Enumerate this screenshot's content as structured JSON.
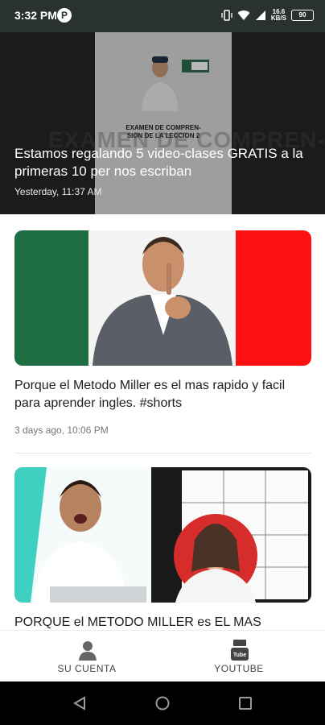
{
  "status_bar": {
    "time": "3:32 PM",
    "badge": "P",
    "net_speed": "16.6\nKB/S",
    "battery": "90"
  },
  "hero": {
    "title": "Estamos regalando 5 video-clases GRATIS a la primeras 10 per nos escriban",
    "time": "Yesterday, 11:37 AM",
    "thumb_text": "EXAMEN DE COMPREN-\nSION DE LA LECCION 2",
    "background_text": "EXAMEN DE COMPREN-"
  },
  "posts": [
    {
      "title": "Porque el Metodo Miller es el mas rapido y facil para aprender ingles. #shorts",
      "time": "3 days ago, 10:06 PM"
    },
    {
      "title": "PORQUE el METODO MILLER es EL MAS"
    }
  ],
  "bottom_nav": {
    "items": [
      {
        "label": "SU CUENTA",
        "icon": "person-icon"
      },
      {
        "label": "YOUTUBE",
        "icon": "youtube-icon"
      }
    ]
  },
  "colors": {
    "status_bar_bg": "#2a3230",
    "flag_green": "#1f6d43",
    "flag_red": "#ff1010"
  }
}
